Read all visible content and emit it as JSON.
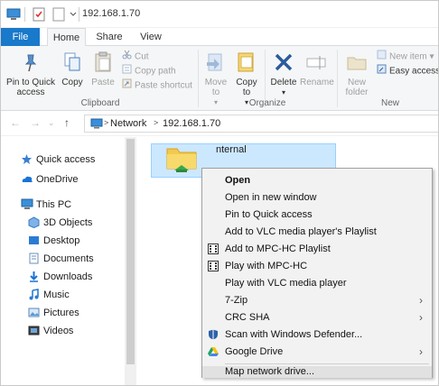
{
  "window": {
    "title": "192.168.1.70"
  },
  "tabs": [
    {
      "label": "File"
    },
    {
      "label": "Home"
    },
    {
      "label": "Share"
    },
    {
      "label": "View"
    }
  ],
  "ribbon": {
    "pin_label": "Pin to Quick access",
    "copy_label": "Copy",
    "paste_label": "Paste",
    "cut_label": "Cut",
    "copy_path_label": "Copy path",
    "paste_shortcut_label": "Paste shortcut",
    "clipboard_group": "Clipboard",
    "move_to_label": "Move to",
    "copy_to_label": "Copy to",
    "delete_label": "Delete",
    "rename_label": "Rename",
    "organize_group": "Organize",
    "new_folder_label": "New folder",
    "new_item_label": "New item",
    "easy_access_label": "Easy access",
    "new_group": "New"
  },
  "address": {
    "crumbs": [
      "Network",
      "192.168.1.70"
    ]
  },
  "navpane": {
    "items": [
      {
        "label": "Quick access",
        "icon": "star-icon"
      },
      {
        "label": "OneDrive",
        "icon": "cloud-icon"
      },
      {
        "label": "This PC",
        "icon": "pc-icon"
      },
      {
        "label": "3D Objects",
        "icon": "cube-icon"
      },
      {
        "label": "Desktop",
        "icon": "desktop-icon"
      },
      {
        "label": "Documents",
        "icon": "documents-icon"
      },
      {
        "label": "Downloads",
        "icon": "download-icon"
      },
      {
        "label": "Music",
        "icon": "music-icon"
      },
      {
        "label": "Pictures",
        "icon": "pictures-icon"
      },
      {
        "label": "Videos",
        "icon": "videos-icon"
      }
    ]
  },
  "content": {
    "item_label": "nternal"
  },
  "context_menu": {
    "items": [
      {
        "label": "Open"
      },
      {
        "label": "Open in new window"
      },
      {
        "label": "Pin to Quick access"
      },
      {
        "label": "Add to VLC media player's Playlist"
      },
      {
        "label": "Add to MPC-HC Playlist"
      },
      {
        "label": "Play with MPC-HC"
      },
      {
        "label": "Play with VLC media player"
      },
      {
        "label": "7-Zip"
      },
      {
        "label": "CRC SHA"
      },
      {
        "label": "Scan with Windows Defender..."
      },
      {
        "label": "Google Drive"
      },
      {
        "label": "Map network drive..."
      }
    ]
  },
  "colors": {
    "accent": "#1979ca",
    "selection": "#cce8ff",
    "menu_bg": "#f2f2f2"
  }
}
